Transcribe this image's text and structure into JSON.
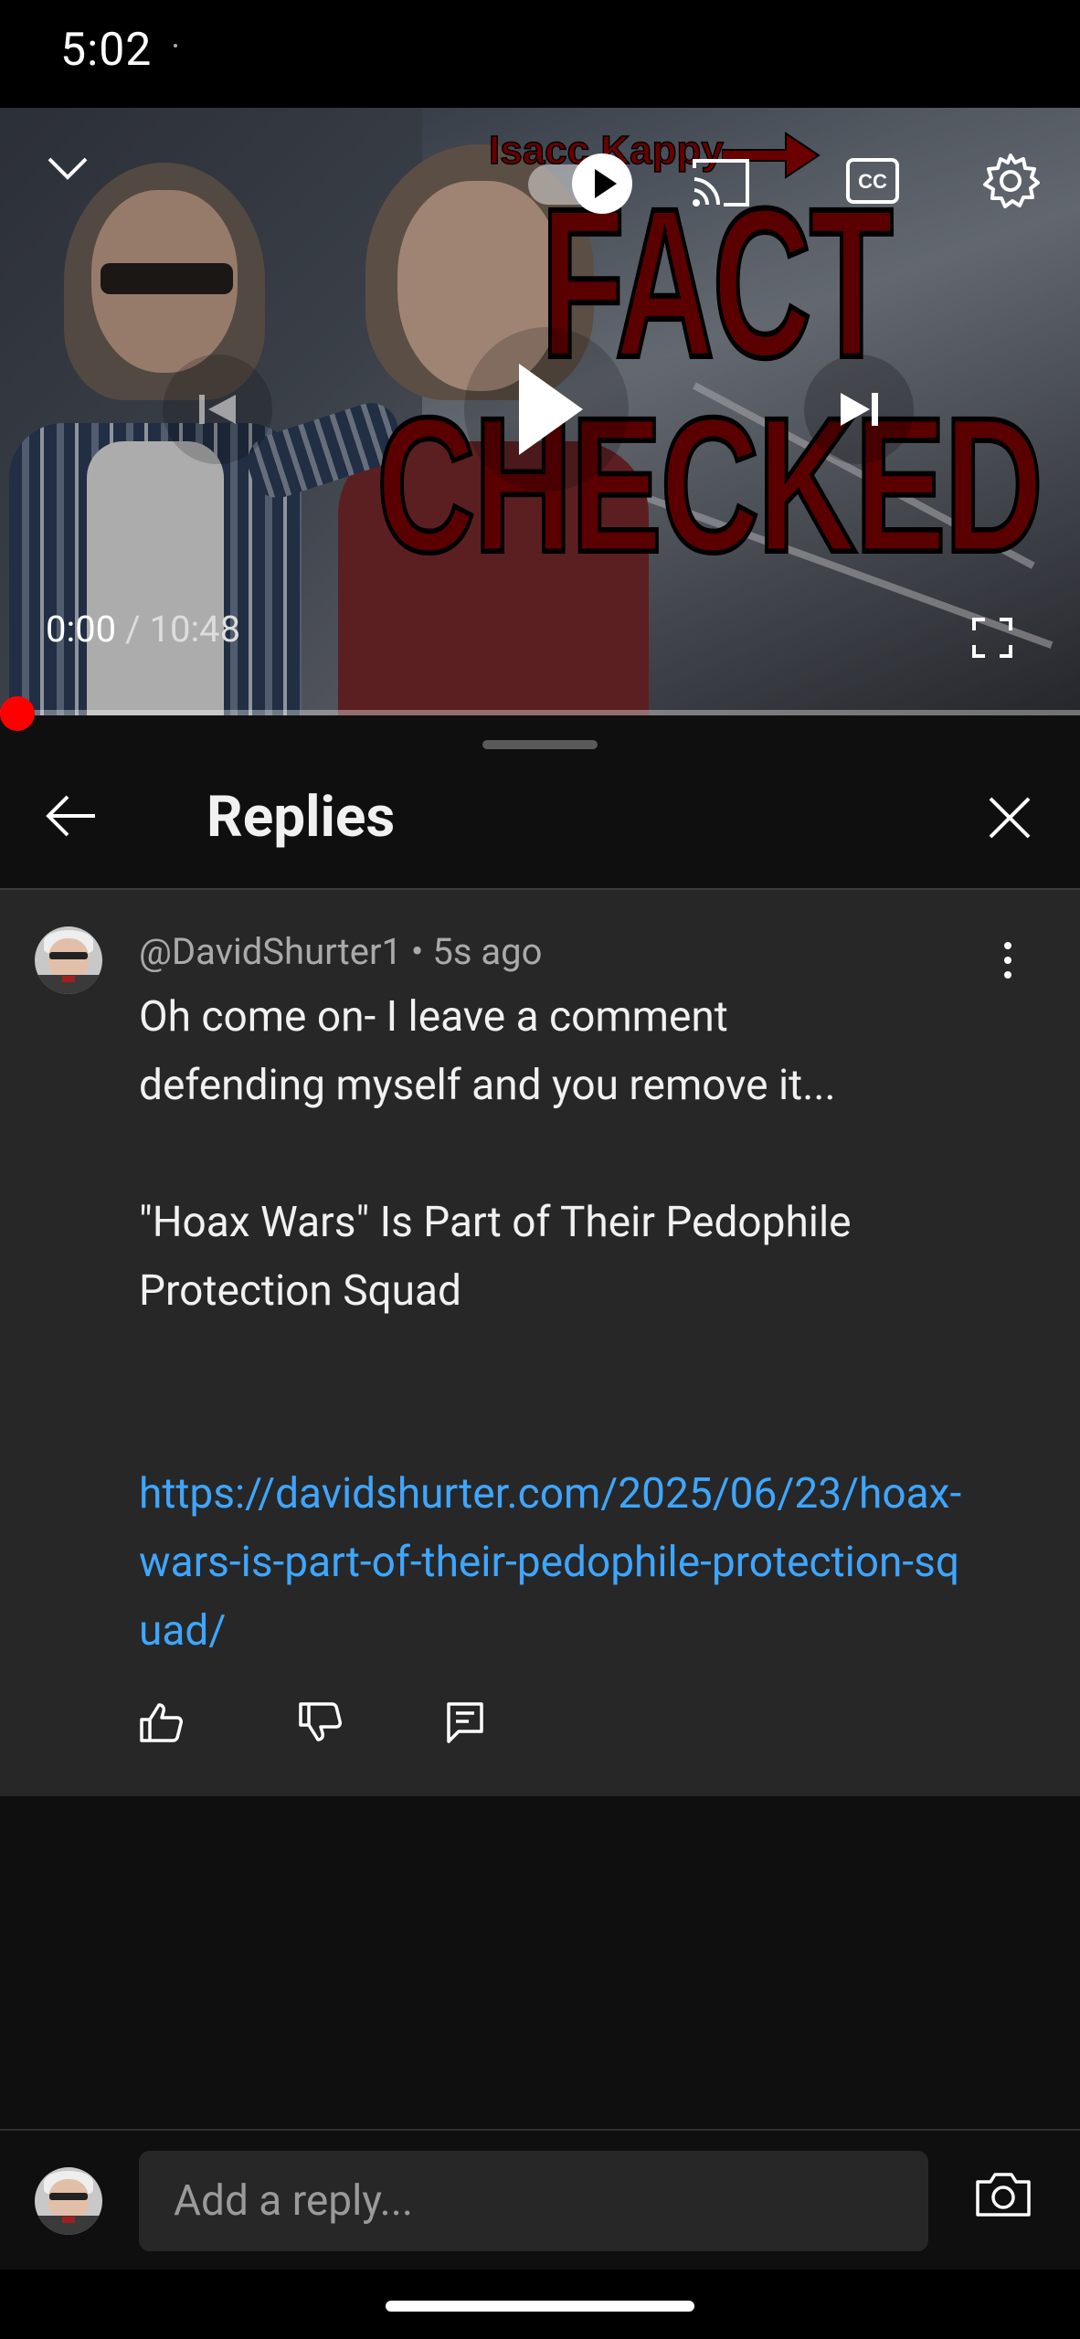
{
  "status_bar": {
    "time": "5:02"
  },
  "player": {
    "thumbnail_text": {
      "banner": "Isacc Kappy",
      "line1": "FACT",
      "line2": "CHECKED"
    },
    "time_current": "0:00",
    "time_separator": "/",
    "time_total": "10:48",
    "progress_fraction": 0.0,
    "icons": [
      "chevron-down-icon",
      "autoplay-toggle",
      "cast-icon",
      "closed-captions-icon",
      "gear-icon",
      "previous-icon",
      "play-icon",
      "next-icon",
      "fullscreen-icon"
    ]
  },
  "replies_panel": {
    "title": "Replies",
    "comment": {
      "author": "@DavidShurter1",
      "dot": "•",
      "age": "5s ago",
      "body": "Oh come on- I leave a comment\ndefending myself and you remove it...\n\n\"Hoax Wars\" Is Part of Their Pedophile\nProtection Squad",
      "link": "https://davidshurter.com/2025/06/23/hoax-wars-is-part-of-their-pedophile-protection-squad/"
    },
    "reply_input": {
      "placeholder": "Add a reply..."
    }
  },
  "colors": {
    "link": "#3ea6ff",
    "progress": "#ff0000",
    "background": "#0f0f0f",
    "card": "#272727"
  }
}
